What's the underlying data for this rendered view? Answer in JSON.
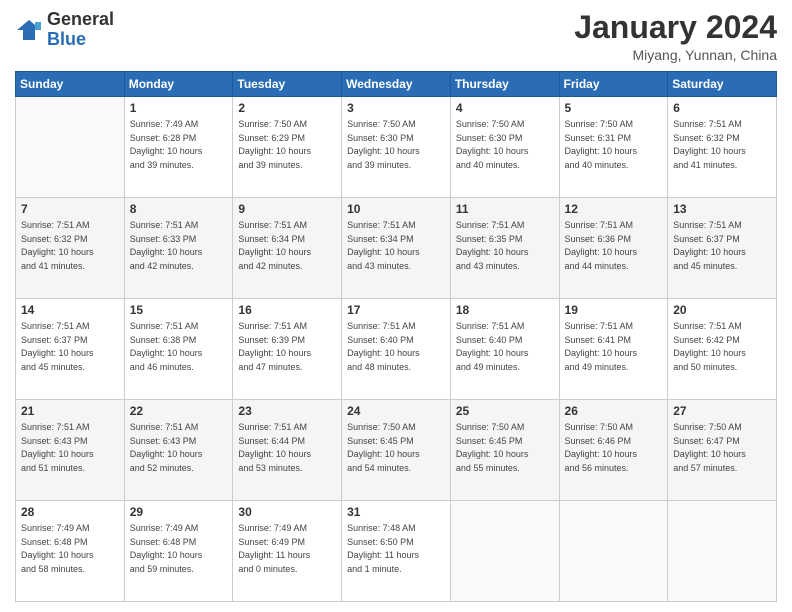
{
  "header": {
    "logo_general": "General",
    "logo_blue": "Blue",
    "title": "January 2024",
    "location": "Miyang, Yunnan, China"
  },
  "days_of_week": [
    "Sunday",
    "Monday",
    "Tuesday",
    "Wednesday",
    "Thursday",
    "Friday",
    "Saturday"
  ],
  "weeks": [
    {
      "shaded": false,
      "days": [
        {
          "num": "",
          "info": ""
        },
        {
          "num": "1",
          "info": "Sunrise: 7:49 AM\nSunset: 6:28 PM\nDaylight: 10 hours\nand 39 minutes."
        },
        {
          "num": "2",
          "info": "Sunrise: 7:50 AM\nSunset: 6:29 PM\nDaylight: 10 hours\nand 39 minutes."
        },
        {
          "num": "3",
          "info": "Sunrise: 7:50 AM\nSunset: 6:30 PM\nDaylight: 10 hours\nand 39 minutes."
        },
        {
          "num": "4",
          "info": "Sunrise: 7:50 AM\nSunset: 6:30 PM\nDaylight: 10 hours\nand 40 minutes."
        },
        {
          "num": "5",
          "info": "Sunrise: 7:50 AM\nSunset: 6:31 PM\nDaylight: 10 hours\nand 40 minutes."
        },
        {
          "num": "6",
          "info": "Sunrise: 7:51 AM\nSunset: 6:32 PM\nDaylight: 10 hours\nand 41 minutes."
        }
      ]
    },
    {
      "shaded": true,
      "days": [
        {
          "num": "7",
          "info": "Sunrise: 7:51 AM\nSunset: 6:32 PM\nDaylight: 10 hours\nand 41 minutes."
        },
        {
          "num": "8",
          "info": "Sunrise: 7:51 AM\nSunset: 6:33 PM\nDaylight: 10 hours\nand 42 minutes."
        },
        {
          "num": "9",
          "info": "Sunrise: 7:51 AM\nSunset: 6:34 PM\nDaylight: 10 hours\nand 42 minutes."
        },
        {
          "num": "10",
          "info": "Sunrise: 7:51 AM\nSunset: 6:34 PM\nDaylight: 10 hours\nand 43 minutes."
        },
        {
          "num": "11",
          "info": "Sunrise: 7:51 AM\nSunset: 6:35 PM\nDaylight: 10 hours\nand 43 minutes."
        },
        {
          "num": "12",
          "info": "Sunrise: 7:51 AM\nSunset: 6:36 PM\nDaylight: 10 hours\nand 44 minutes."
        },
        {
          "num": "13",
          "info": "Sunrise: 7:51 AM\nSunset: 6:37 PM\nDaylight: 10 hours\nand 45 minutes."
        }
      ]
    },
    {
      "shaded": false,
      "days": [
        {
          "num": "14",
          "info": "Sunrise: 7:51 AM\nSunset: 6:37 PM\nDaylight: 10 hours\nand 45 minutes."
        },
        {
          "num": "15",
          "info": "Sunrise: 7:51 AM\nSunset: 6:38 PM\nDaylight: 10 hours\nand 46 minutes."
        },
        {
          "num": "16",
          "info": "Sunrise: 7:51 AM\nSunset: 6:39 PM\nDaylight: 10 hours\nand 47 minutes."
        },
        {
          "num": "17",
          "info": "Sunrise: 7:51 AM\nSunset: 6:40 PM\nDaylight: 10 hours\nand 48 minutes."
        },
        {
          "num": "18",
          "info": "Sunrise: 7:51 AM\nSunset: 6:40 PM\nDaylight: 10 hours\nand 49 minutes."
        },
        {
          "num": "19",
          "info": "Sunrise: 7:51 AM\nSunset: 6:41 PM\nDaylight: 10 hours\nand 49 minutes."
        },
        {
          "num": "20",
          "info": "Sunrise: 7:51 AM\nSunset: 6:42 PM\nDaylight: 10 hours\nand 50 minutes."
        }
      ]
    },
    {
      "shaded": true,
      "days": [
        {
          "num": "21",
          "info": "Sunrise: 7:51 AM\nSunset: 6:43 PM\nDaylight: 10 hours\nand 51 minutes."
        },
        {
          "num": "22",
          "info": "Sunrise: 7:51 AM\nSunset: 6:43 PM\nDaylight: 10 hours\nand 52 minutes."
        },
        {
          "num": "23",
          "info": "Sunrise: 7:51 AM\nSunset: 6:44 PM\nDaylight: 10 hours\nand 53 minutes."
        },
        {
          "num": "24",
          "info": "Sunrise: 7:50 AM\nSunset: 6:45 PM\nDaylight: 10 hours\nand 54 minutes."
        },
        {
          "num": "25",
          "info": "Sunrise: 7:50 AM\nSunset: 6:45 PM\nDaylight: 10 hours\nand 55 minutes."
        },
        {
          "num": "26",
          "info": "Sunrise: 7:50 AM\nSunset: 6:46 PM\nDaylight: 10 hours\nand 56 minutes."
        },
        {
          "num": "27",
          "info": "Sunrise: 7:50 AM\nSunset: 6:47 PM\nDaylight: 10 hours\nand 57 minutes."
        }
      ]
    },
    {
      "shaded": false,
      "days": [
        {
          "num": "28",
          "info": "Sunrise: 7:49 AM\nSunset: 6:48 PM\nDaylight: 10 hours\nand 58 minutes."
        },
        {
          "num": "29",
          "info": "Sunrise: 7:49 AM\nSunset: 6:48 PM\nDaylight: 10 hours\nand 59 minutes."
        },
        {
          "num": "30",
          "info": "Sunrise: 7:49 AM\nSunset: 6:49 PM\nDaylight: 11 hours\nand 0 minutes."
        },
        {
          "num": "31",
          "info": "Sunrise: 7:48 AM\nSunset: 6:50 PM\nDaylight: 11 hours\nand 1 minute."
        },
        {
          "num": "",
          "info": ""
        },
        {
          "num": "",
          "info": ""
        },
        {
          "num": "",
          "info": ""
        }
      ]
    }
  ]
}
